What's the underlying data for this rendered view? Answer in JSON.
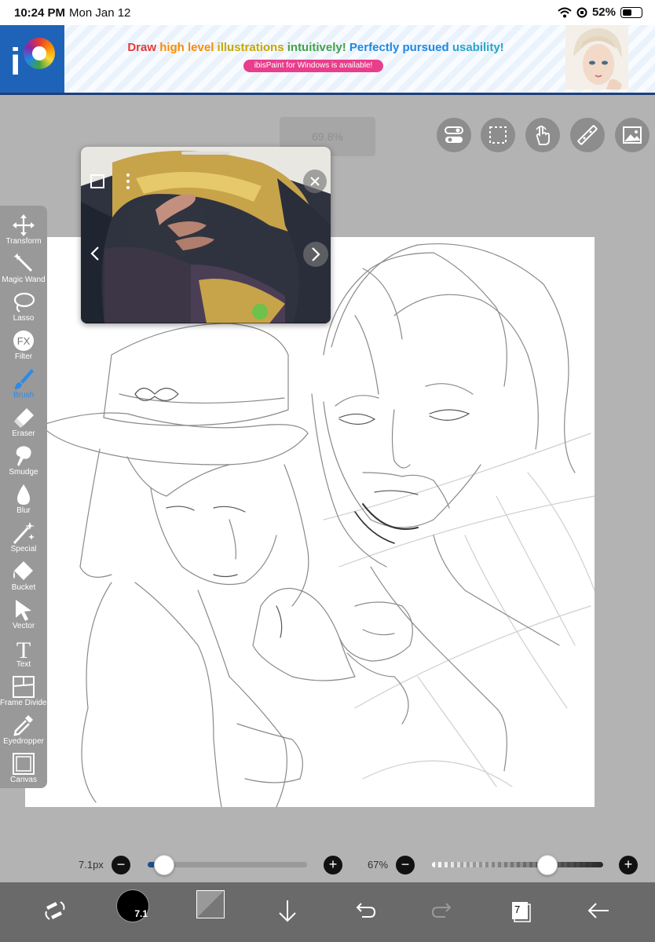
{
  "status_bar": {
    "time": "10:24 PM",
    "date": "Mon Jan 12",
    "battery_percent": "52%",
    "battery_level": 0.52
  },
  "ad": {
    "headline_words": [
      "Draw",
      "high level",
      "illustrations",
      "intuitively!",
      "Perfectly pursued",
      "usability!"
    ],
    "sub_text": "ibisPaint for Windows is available!",
    "logo_letter": "i"
  },
  "canvas": {
    "zoom_label": "69.8%"
  },
  "top_toolbar": {
    "buttons": [
      {
        "icon": "toggle-icon",
        "name": "toggle-button"
      },
      {
        "icon": "selection-icon",
        "name": "selection-button"
      },
      {
        "icon": "hand-icon",
        "name": "hand-button"
      },
      {
        "icon": "ruler-icon",
        "name": "ruler-button"
      },
      {
        "icon": "image-icon",
        "name": "image-button"
      }
    ]
  },
  "tools": [
    {
      "label": "Transform",
      "icon": "move-icon"
    },
    {
      "label": "Magic Wand",
      "icon": "magic-wand-icon"
    },
    {
      "label": "Lasso",
      "icon": "lasso-icon"
    },
    {
      "label": "Filter",
      "icon": "fx-icon",
      "glyph": "FX"
    },
    {
      "label": "Brush",
      "icon": "brush-icon",
      "active": true
    },
    {
      "label": "Eraser",
      "icon": "eraser-icon"
    },
    {
      "label": "Smudge",
      "icon": "smudge-icon"
    },
    {
      "label": "Blur",
      "icon": "blur-icon"
    },
    {
      "label": "Special",
      "icon": "sparkle-icon"
    },
    {
      "label": "Bucket",
      "icon": "bucket-icon"
    },
    {
      "label": "Vector",
      "icon": "cursor-icon"
    },
    {
      "label": "Text",
      "icon": "text-icon",
      "glyph": "T"
    },
    {
      "label": "Frame Divider",
      "icon": "frame-divider-icon"
    },
    {
      "label": "Eyedropper",
      "icon": "eyedropper-icon"
    },
    {
      "label": "Canvas",
      "icon": "canvas-icon"
    }
  ],
  "brush_size": {
    "value": "7.1px",
    "level": 0.1
  },
  "opacity": {
    "value": "67%",
    "level": 0.67
  },
  "bottom_bar": {
    "brush_badge": "7.1",
    "layer_count": "7"
  }
}
